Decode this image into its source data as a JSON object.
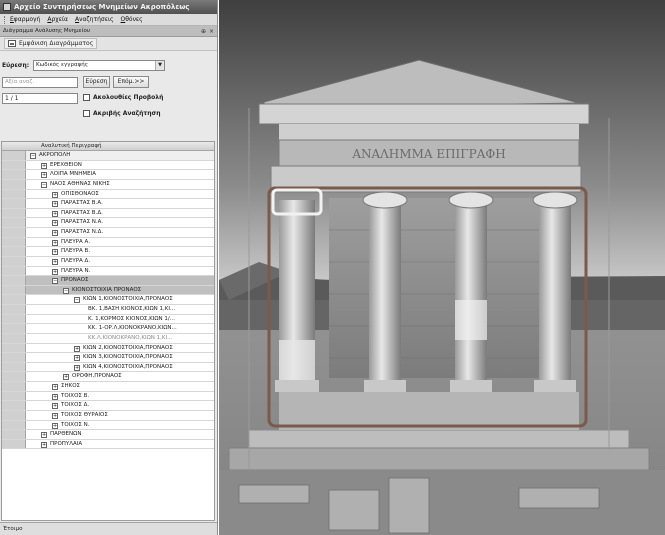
{
  "app": {
    "title": "Αρχείο Συντηρήσεως Μνημείων Ακροπόλεως"
  },
  "menu": [
    "Εφαρμογή",
    "Αρχεία",
    "Αναζητήσεις",
    "Οθόνες"
  ],
  "panel": {
    "title": "Διάγραμμα Ανάλυσης Μνημείου",
    "btn1": "⊕",
    "btn2": "×"
  },
  "toolbar": {
    "label": "Εμφάνιση Διαγράμματος"
  },
  "search": {
    "label": "Εύρεση:",
    "field_value": "Κωδικός εγγραφής",
    "placeholder": "Αξία αναζ.",
    "find_button": "Εύρεση",
    "next_button": "Επόμ.>>",
    "pager": "1 / 1",
    "option1": "Ακολουθίες Προβολή",
    "option2": "Ακριβής Αναζήτηση"
  },
  "grid": {
    "column_header": "Αναλυτική Περιγραφή",
    "rows": [
      {
        "level": 0,
        "exp": "−",
        "text": "ΑΚΡΟΠΟΛΗ"
      },
      {
        "level": 1,
        "exp": "+",
        "text": "ΕΡΕΧΘΕΙΟΝ"
      },
      {
        "level": 1,
        "exp": "+",
        "text": "ΛΟΙΠΑ ΜΝΗΜΕΙΑ"
      },
      {
        "level": 1,
        "exp": "−",
        "text": "ΝΑΟΣ ΑΘΗΝΑΣ ΝΙΚΗΣ"
      },
      {
        "level": 2,
        "exp": "+",
        "text": "ΟΠΙΣΘΟΝΑΟΣ"
      },
      {
        "level": 2,
        "exp": "+",
        "text": "ΠΑΡΑΣΤΑΣ Β.Α."
      },
      {
        "level": 2,
        "exp": "+",
        "text": "ΠΑΡΑΣΤΑΣ Β.Δ."
      },
      {
        "level": 2,
        "exp": "+",
        "text": "ΠΑΡΑΣΤΑΣ Ν.Α."
      },
      {
        "level": 2,
        "exp": "+",
        "text": "ΠΑΡΑΣΤΑΣ Ν.Δ."
      },
      {
        "level": 2,
        "exp": "+",
        "text": "ΠΛΕΥΡΑ Α."
      },
      {
        "level": 2,
        "exp": "+",
        "text": "ΠΛΕΥΡΑ Β."
      },
      {
        "level": 2,
        "exp": "+",
        "text": "ΠΛΕΥΡΑ Δ."
      },
      {
        "level": 2,
        "exp": "+",
        "text": "ΠΛΕΥΡΑ Ν."
      },
      {
        "level": 2,
        "exp": "−",
        "text": "ΠΡΟΝΑΟΣ"
      },
      {
        "level": 3,
        "exp": "−",
        "text": "ΚΙΟΝΟΣΤΟΙΧΙΑ ΠΡΟΝΑΟΣ"
      },
      {
        "level": 4,
        "exp": "−",
        "text": "ΚΙΩΝ 1,ΚΙΟΝΟΣΤΟΙΧΙΑ,ΠΡΟΝΑΟΣ"
      },
      {
        "level": 5,
        "exp": "",
        "text": "ΒΚ. 1,ΒΑΣΗ ΚΙΟΝΟΣ,ΚΙΩΝ 1,ΚΙ..."
      },
      {
        "level": 5,
        "exp": "",
        "text": "Κ. 1,ΚΟΡΜΟΣ ΚΙΟΝΟΣ,ΚΙΩΝ 1/..."
      },
      {
        "level": 5,
        "exp": "",
        "text": "ΚΚ. 1-ΟΡ.Λ,ΚΙΟΝΟΚΡΑΝΟ,ΚΙΩΝ..."
      },
      {
        "level": 5,
        "exp": "",
        "text": "ΚΚ.Λ,ΚΙΟΝΟΚΡΑΝΟ,ΚΙΩΝ 1,ΚΙ...",
        "dim": true
      },
      {
        "level": 4,
        "exp": "+",
        "text": "ΚΙΩΝ 2,ΚΙΟΝΟΣΤΟΙΧΙΑ,ΠΡΟΝΑΟΣ"
      },
      {
        "level": 4,
        "exp": "+",
        "text": "ΚΙΩΝ 3,ΚΙΟΝΟΣΤΟΙΧΙΑ,ΠΡΟΝΑΟΣ"
      },
      {
        "level": 4,
        "exp": "+",
        "text": "ΚΙΩΝ 4,ΚΙΟΝΟΣΤΟΙΧΙΑ,ΠΡΟΝΑΟΣ"
      },
      {
        "level": 3,
        "exp": "+",
        "text": "ΟΡΟΦΗ,ΠΡΟΝΑΟΣ"
      },
      {
        "level": 2,
        "exp": "+",
        "text": "ΣΗΚΟΣ"
      },
      {
        "level": 2,
        "exp": "+",
        "text": "ΤΟΙΧΟΣ Β."
      },
      {
        "level": 2,
        "exp": "+",
        "text": "ΤΟΙΧΟΣ Δ."
      },
      {
        "level": 2,
        "exp": "+",
        "text": "ΤΟΙΧΟΣ ΘΥΡΑΙΟΣ"
      },
      {
        "level": 2,
        "exp": "+",
        "text": "ΤΟΙΧΟΣ Ν."
      },
      {
        "level": 1,
        "exp": "+",
        "text": "ΠΑΡΘΕΝΩΝ"
      },
      {
        "level": 1,
        "exp": "+",
        "text": "ΠΡΟΠΥΛΑΙΑ"
      }
    ]
  },
  "status": {
    "text": "Έτοιμο"
  },
  "photo": {
    "frieze_text": "ΑΝΑΛΗΜΜΑ ΕΠΙΓΡΑΦΗ",
    "highlight_color": "#7a5a4a",
    "selected_color": "#f2f2f2"
  }
}
